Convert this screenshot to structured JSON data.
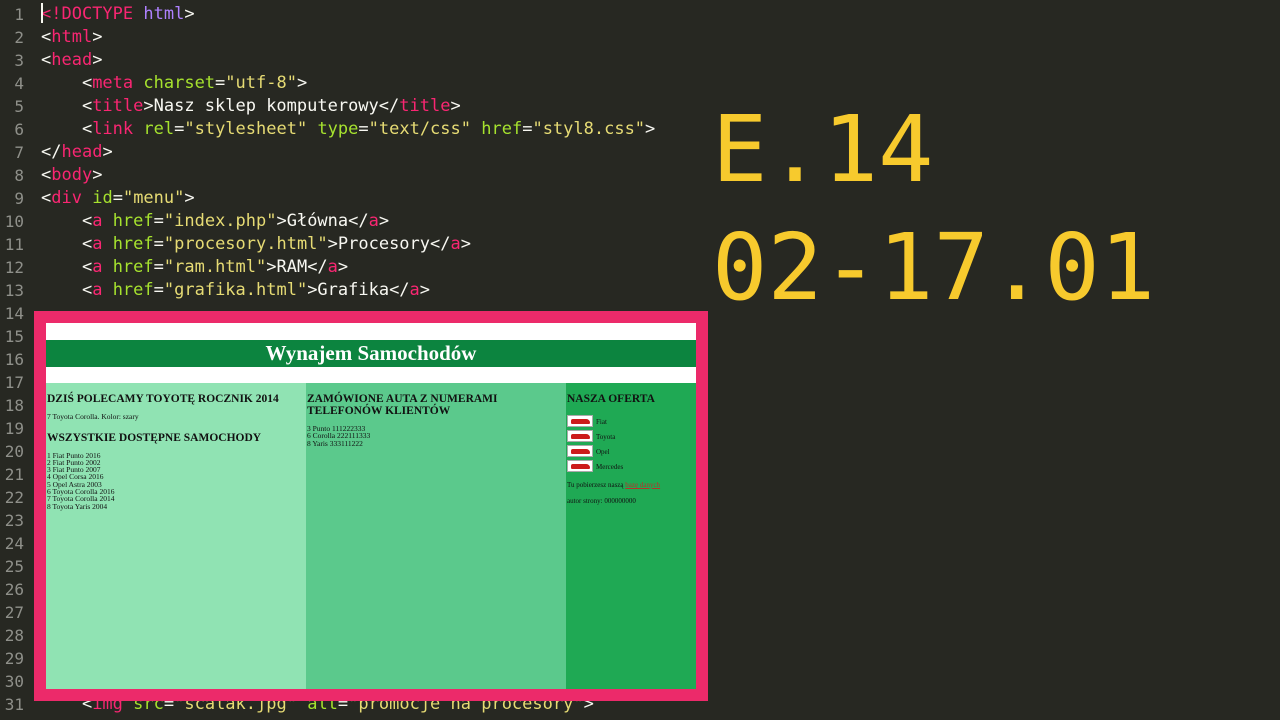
{
  "editor": {
    "lines": [
      {
        "n": "1",
        "html": "<span class='tag'>&lt;!DOCTYPE</span> <span class='kw'>html</span>&gt;"
      },
      {
        "n": "2",
        "html": "&lt;<span class='tag'>html</span>&gt;"
      },
      {
        "n": "3",
        "html": "&lt;<span class='tag'>head</span>&gt;"
      },
      {
        "n": "4",
        "html": "    &lt;<span class='tag'>meta</span> <span class='attr'>charset</span>=<span class='str'>\"utf-8\"</span>&gt;"
      },
      {
        "n": "5",
        "html": "    &lt;<span class='tag'>title</span>&gt;Nasz sklep komputerowy&lt;/<span class='tag'>title</span>&gt;"
      },
      {
        "n": "6",
        "html": "    &lt;<span class='tag'>link</span> <span class='attr'>rel</span>=<span class='str'>\"stylesheet\"</span> <span class='attr'>type</span>=<span class='str'>\"text/css\"</span> <span class='attr'>href</span>=<span class='str'>\"styl8.css\"</span>&gt;"
      },
      {
        "n": "7",
        "html": "&lt;/<span class='tag'>head</span>&gt;"
      },
      {
        "n": "8",
        "html": "&lt;<span class='tag'>body</span>&gt;"
      },
      {
        "n": "9",
        "html": "&lt;<span class='tag'>div</span> <span class='attr'>id</span>=<span class='str'>\"menu\"</span>&gt;"
      },
      {
        "n": "10",
        "html": "    &lt;<span class='tag'>a</span> <span class='attr'>href</span>=<span class='str'>\"index.php\"</span>&gt;Główna&lt;/<span class='tag'>a</span>&gt;"
      },
      {
        "n": "11",
        "html": "    &lt;<span class='tag'>a</span> <span class='attr'>href</span>=<span class='str'>\"procesory.html\"</span>&gt;Procesory&lt;/<span class='tag'>a</span>&gt;"
      },
      {
        "n": "12",
        "html": "    &lt;<span class='tag'>a</span> <span class='attr'>href</span>=<span class='str'>\"ram.html\"</span>&gt;RAM&lt;/<span class='tag'>a</span>&gt;"
      },
      {
        "n": "13",
        "html": "    &lt;<span class='tag'>a</span> <span class='attr'>href</span>=<span class='str'>\"grafika.html\"</span>&gt;Grafika&lt;/<span class='tag'>a</span>&gt;"
      },
      {
        "n": "14",
        "html": ""
      },
      {
        "n": "15",
        "html": ""
      },
      {
        "n": "16",
        "html": ""
      },
      {
        "n": "17",
        "html": ""
      },
      {
        "n": "18",
        "html": ""
      },
      {
        "n": "19",
        "html": ""
      },
      {
        "n": "20",
        "html": ""
      },
      {
        "n": "21",
        "html": ""
      },
      {
        "n": "22",
        "html": ""
      },
      {
        "n": "23",
        "html": ""
      },
      {
        "n": "24",
        "html": ""
      },
      {
        "n": "25",
        "html": ""
      },
      {
        "n": "26",
        "html": ""
      },
      {
        "n": "27",
        "html": ""
      },
      {
        "n": "28",
        "html": ""
      },
      {
        "n": "29",
        "html": ""
      },
      {
        "n": "30",
        "html": ""
      },
      {
        "n": "31",
        "html": "    &lt;<span class='tag'>img</span> <span class='attr'>src</span>=<span class='str'>\"scalak.jpg\"</span> <span class='attr'>alt</span>=<span class='str'>\"promocje na procesory\"</span>&gt;"
      }
    ]
  },
  "exam": {
    "code": "E.14",
    "date": "02-17.01"
  },
  "site": {
    "banner": "Wynajem Samochodów",
    "left": {
      "heading1": "DZIŚ POLECAMY TOYOTĘ ROCZNIK 2014",
      "featured": "7 Toyota Corolla. Kolor: szary",
      "heading2": "WSZYSTKIE DOSTĘPNE SAMOCHODY",
      "cars": [
        "1 Fiat Punto 2016",
        "2 Fiat Punto 2002",
        "3 Fiat Punto 2007",
        "4 Opel Corsa 2016",
        "5 Opel Astra 2003",
        "6 Toyota Corolla 2016",
        "7 Toyota Corolla 2014",
        "8 Toyota Yaris 2004"
      ]
    },
    "middle": {
      "heading": "ZAMÓWIONE AUTA Z NUMERAMI TELEFONÓW KLIENTÓW",
      "orders": [
        "3 Punto 111222333",
        "6 Corolla 222111333",
        "8 Yaris 333111222"
      ]
    },
    "right": {
      "heading": "NASZA OFERTA",
      "offers": [
        "Fiat",
        "Toyota",
        "Opel",
        "Mercedes"
      ],
      "download_text": "Tu pobierzesz naszą",
      "download_link": "bazę danych",
      "author": "autor strony: 000000000"
    }
  }
}
